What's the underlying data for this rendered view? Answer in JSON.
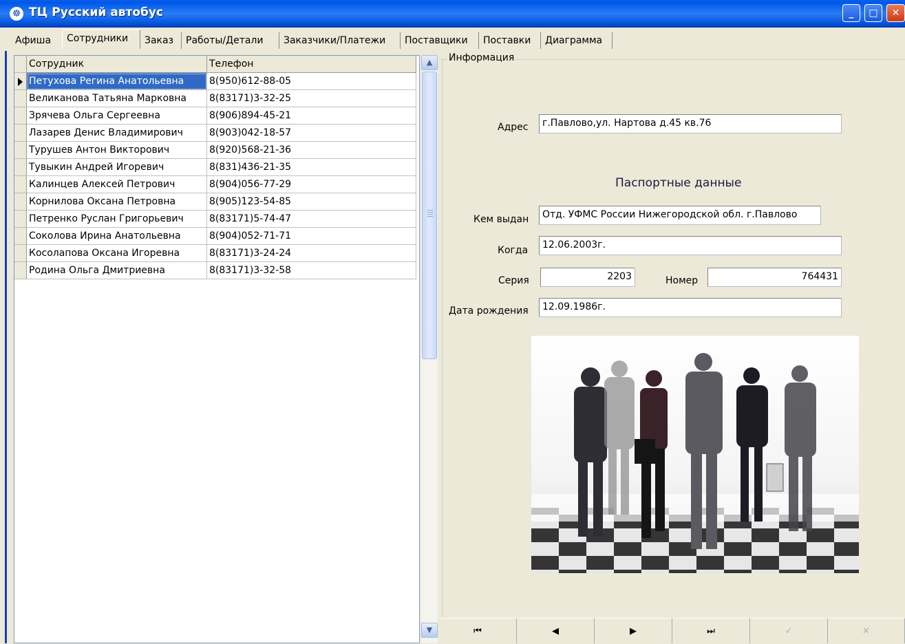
{
  "window": {
    "title": "ТЦ Русский автобус",
    "icon": "globe-icon"
  },
  "tabs": [
    {
      "label": "Афиша"
    },
    {
      "label": "Сотрудники",
      "active": true
    },
    {
      "label": "Заказ"
    },
    {
      "label": "Работы/Детали"
    },
    {
      "label": "Заказчики/Платежи"
    },
    {
      "label": "Поставщики"
    },
    {
      "label": "Поставки"
    },
    {
      "label": "Диаграмма"
    }
  ],
  "grid": {
    "columns": [
      "Сотрудник",
      "Телефон"
    ],
    "rows": [
      {
        "name": "Петухова Регина Анатольевна",
        "phone": "8(950)612-88-05",
        "selected": true
      },
      {
        "name": "Великанова Татьяна Марковна",
        "phone": "8(83171)3-32-25"
      },
      {
        "name": "Зрячева Ольга Сергеевна",
        "phone": "8(906)894-45-21"
      },
      {
        "name": "Лазарев Денис Владимирович",
        "phone": "8(903)042-18-57"
      },
      {
        "name": "Турушев Антон Викторович",
        "phone": "8(920)568-21-36"
      },
      {
        "name": "Тувыкин Андрей Игоревич",
        "phone": "8(831)436-21-35"
      },
      {
        "name": "Калинцев Алексей Петрович",
        "phone": "8(904)056-77-29"
      },
      {
        "name": "Корнилова Оксана Петровна",
        "phone": "8(905)123-54-85"
      },
      {
        "name": "Петренко Руслан Григорьевич",
        "phone": "8(83171)5-74-47"
      },
      {
        "name": "Соколова Ирина Анатольевна",
        "phone": "8(904)052-71-71"
      },
      {
        "name": "Косолапова Оксана Игоревна",
        "phone": "8(83171)3-24-24"
      },
      {
        "name": "Родина Ольга Дмитриевна",
        "phone": "8(83171)3-32-58"
      }
    ]
  },
  "info": {
    "group_label": "Информация",
    "address_label": "Адрес",
    "address_value": "г.Павлово,ул. Нартова д.45 кв.76",
    "passport_title": "Паспортные данные",
    "issued_by_label": "Кем выдан",
    "issued_by_value": "Отд. УФМС России Нижегородской обл. г.Павлово",
    "when_label": "Когда",
    "when_value": "12.06.2003г.",
    "series_label": "Серия",
    "series_value": "2203",
    "number_label": "Номер",
    "number_value": "764431",
    "birth_label": "Дата рождения",
    "birth_value": "12.09.1986г."
  },
  "navigator": {
    "first": "first-record-icon",
    "prior": "prior-record-icon",
    "next": "next-record-icon",
    "last": "last-record-icon",
    "post": "post-check-icon",
    "cancel": "cancel-x-icon"
  }
}
